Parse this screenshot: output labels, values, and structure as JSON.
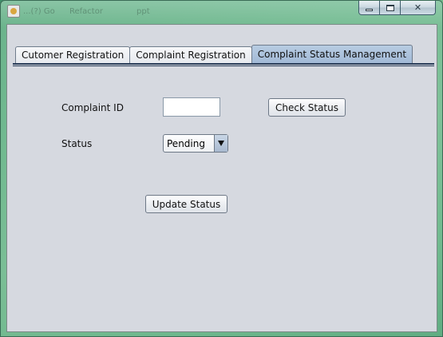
{
  "window": {
    "title_ghost": [
      "...(?) Go",
      "Refactor",
      "ppt"
    ],
    "controls": {
      "minimize": "",
      "maximize": "",
      "close": "✕"
    }
  },
  "tabs": [
    {
      "label": "Cutomer Registration",
      "active": false
    },
    {
      "label": "Complaint Registration",
      "active": false
    },
    {
      "label": "Complaint Status Management",
      "active": true
    }
  ],
  "form": {
    "complaint_id_label": "Complaint ID",
    "complaint_id_value": "",
    "check_status_label": "Check Status",
    "status_label": "Status",
    "status_selected": "Pending",
    "update_status_label": "Update Status"
  }
}
